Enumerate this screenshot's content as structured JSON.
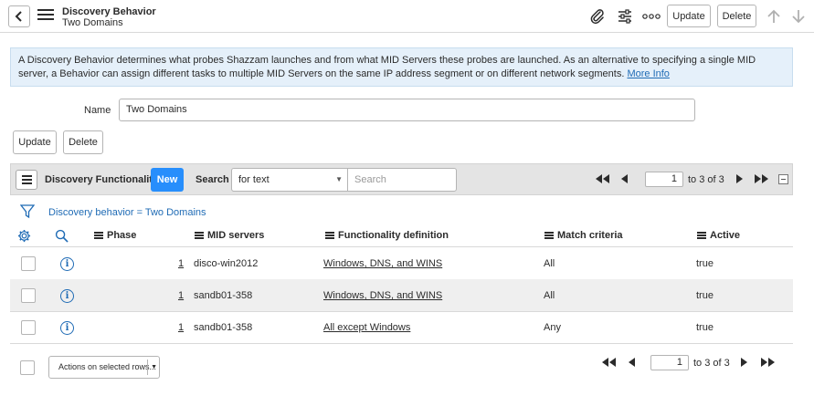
{
  "header": {
    "title": "Discovery Behavior",
    "subtitle": "Two Domains",
    "update_label": "Update",
    "delete_label": "Delete"
  },
  "banner": {
    "text": "A Discovery Behavior determines what probes Shazzam launches and from what MID Servers these probes are launched. As an alternative to specifying a single MID server, a Behavior can assign different tasks to multiple MID Servers on the same IP address segment or on different network segments.",
    "link": "More Info"
  },
  "form": {
    "name_label": "Name",
    "name_value": "Two Domains",
    "update_label": "Update",
    "delete_label": "Delete"
  },
  "related_list": {
    "title": "Discovery Functionality",
    "new_label": "New",
    "search_label": "Search",
    "search_field": "for text",
    "search_placeholder": "Search",
    "page": "1",
    "page_of": "to 3 of 3",
    "filter": "Discovery behavior = Two Domains",
    "columns": [
      "Phase",
      "MID servers",
      "Functionality definition",
      "Match criteria",
      "Active"
    ],
    "rows": [
      {
        "phase": "1",
        "mid": "disco-win2012",
        "func": "Windows, DNS, and WINS",
        "match": "All",
        "active": "true"
      },
      {
        "phase": "1",
        "mid": "sandb01-358",
        "func": "Windows, DNS, and WINS",
        "match": "All",
        "active": "true"
      },
      {
        "phase": "1",
        "mid": "sandb01-358",
        "func": "All except Windows",
        "match": "Any",
        "active": "true"
      }
    ]
  },
  "footer": {
    "actions_label": "Actions on selected rows...",
    "page": "1",
    "page_of": "to 3 of 3"
  },
  "colors": {
    "accent": "#278efc",
    "link": "#1f6bb5",
    "banner_bg": "#e5f0fa"
  }
}
